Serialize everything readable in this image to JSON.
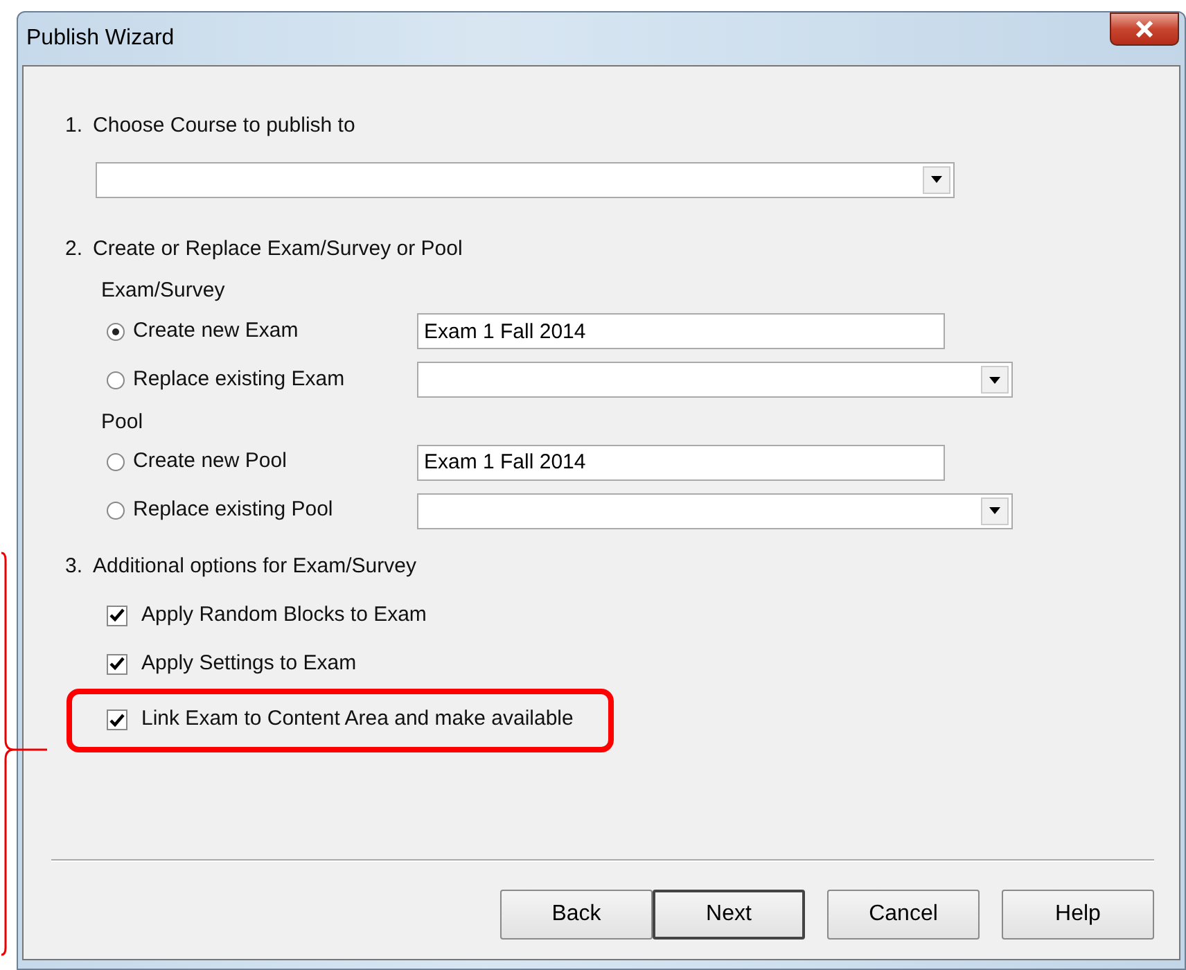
{
  "window": {
    "title": "Publish Wizard"
  },
  "step1": {
    "number": "1.",
    "label": "Choose Course to publish to"
  },
  "step2": {
    "number": "2.",
    "label": "Create or Replace Exam/Survey or Pool",
    "groups": [
      {
        "label": "Exam/Survey",
        "options": [
          {
            "label": "Create new Exam",
            "selected": true,
            "kind": "text",
            "value": "Exam 1 Fall 2014"
          },
          {
            "label": "Replace existing Exam",
            "selected": false,
            "kind": "dropdown"
          }
        ]
      },
      {
        "label": "Pool",
        "options": [
          {
            "label": "Create new Pool",
            "selected": false,
            "kind": "text",
            "value": "Exam 1 Fall 2014"
          },
          {
            "label": "Replace existing Pool",
            "selected": false,
            "kind": "dropdown"
          }
        ]
      }
    ]
  },
  "step3": {
    "number": "3.",
    "label": "Additional options for Exam/Survey",
    "options": [
      {
        "label": "Apply Random Blocks to Exam",
        "checked": true,
        "highlighted": false
      },
      {
        "label": "Apply Settings to Exam",
        "checked": true,
        "highlighted": false
      },
      {
        "label": "Link Exam to Content Area and make available",
        "checked": true,
        "highlighted": true
      }
    ]
  },
  "buttons": [
    {
      "label": "Back",
      "default": false
    },
    {
      "label": "Next",
      "default": true
    },
    {
      "label": "Cancel",
      "default": false
    },
    {
      "label": "Help",
      "default": false
    }
  ]
}
